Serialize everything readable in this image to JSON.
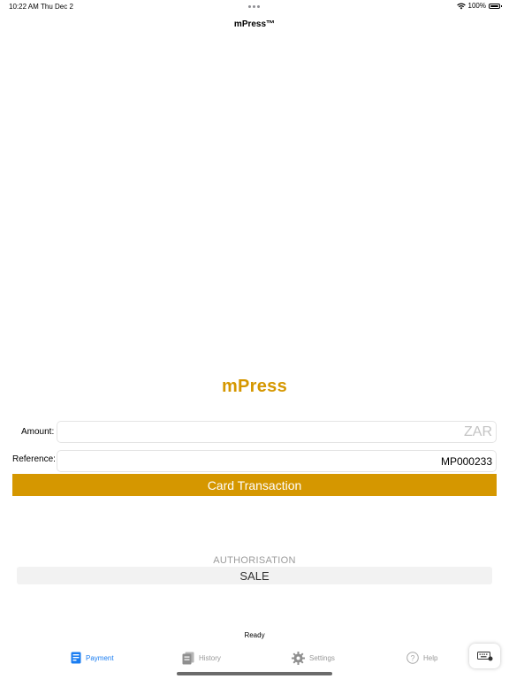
{
  "status_bar": {
    "time": "10:22 AM",
    "date": "Thu Dec 2",
    "battery": "100%"
  },
  "nav": {
    "title": "mPress™"
  },
  "logo": {
    "text": "mPress"
  },
  "form": {
    "amount_label": "Amount:",
    "amount_value": "",
    "amount_placeholder": "ZAR",
    "reference_label": "Reference:",
    "reference_value": "MP000233",
    "card_transaction_label": "Card Transaction"
  },
  "transaction": {
    "type_label": "AUTHORISATION",
    "selected_type": "SALE"
  },
  "status": {
    "text": "Ready"
  },
  "tabbar": {
    "items": [
      {
        "label": "Payment",
        "icon": "payment-icon",
        "active": true
      },
      {
        "label": "History",
        "icon": "history-icon",
        "active": false
      },
      {
        "label": "Settings",
        "icon": "gear-icon",
        "active": false
      },
      {
        "label": "Help",
        "icon": "help-icon",
        "active": false
      }
    ]
  },
  "colors": {
    "accent": "#d59700",
    "tab_active": "#1a7df1",
    "tab_inactive": "#999999"
  }
}
